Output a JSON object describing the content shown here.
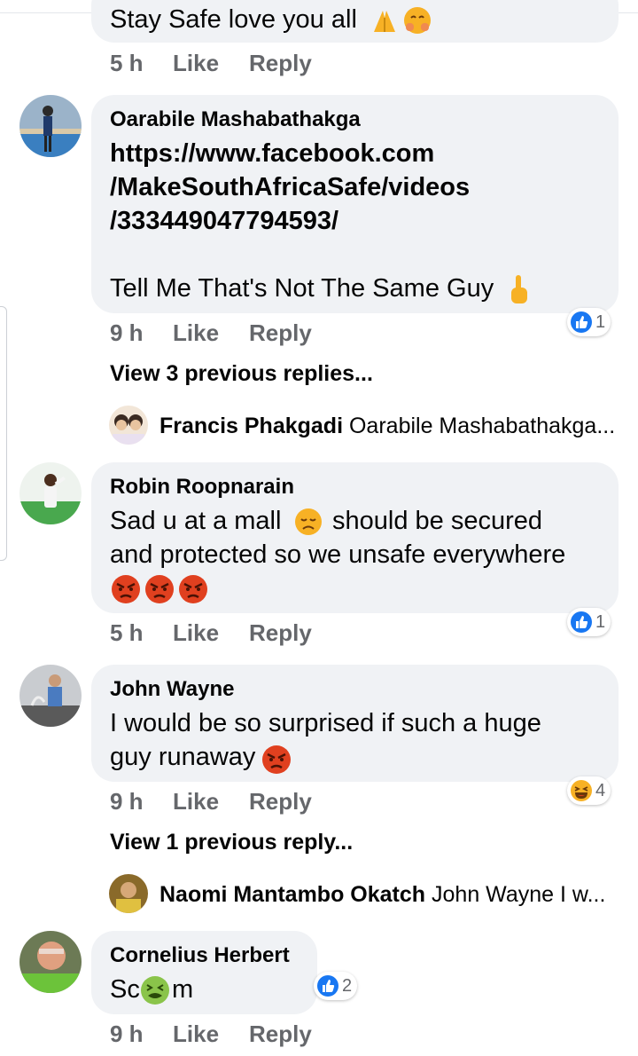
{
  "comments": [
    {
      "text": "Stay Safe love you all",
      "time": "5 h",
      "like": "Like",
      "reply": "Reply"
    },
    {
      "author": "Oarabile Mashabathakga",
      "link_lines": [
        "https://www.facebook.com",
        "/MakeSouthAfricaSafe/videos",
        "/333449047794593/"
      ],
      "text": "Tell Me That's Not The Same Guy",
      "reaction_icon": "like-icon",
      "reaction_count": "1",
      "time": "9 h",
      "like": "Like",
      "reply": "Reply",
      "view_previous": "View 3 previous replies...",
      "latest_reply": {
        "author": "Francis Phakgadi",
        "text": "Oarabile Mashabathakga..."
      }
    },
    {
      "author": "Robin Roopnarain",
      "text_line1": "Sad u at a mall",
      "text_line1b": "should be secured",
      "text_line2": "and protected so we unsafe everywhere",
      "reaction_icon": "like-icon",
      "reaction_count": "1",
      "time": "5 h",
      "like": "Like",
      "reply": "Reply"
    },
    {
      "author": "John Wayne",
      "text_line1": "I would be so surprised if such a huge",
      "text_line2": "guy runaway",
      "reaction_icon": "haha-icon",
      "reaction_count": "4",
      "time": "9 h",
      "like": "Like",
      "reply": "Reply",
      "view_previous": "View 1 previous reply...",
      "latest_reply": {
        "author": "Naomi Mantambo Okatch",
        "text": "John Wayne I w..."
      }
    },
    {
      "author": "Cornelius Herbert",
      "text_a": "Sc",
      "text_b": "m",
      "reaction_icon": "like-icon",
      "reaction_count": "2",
      "time": "9 h",
      "like": "Like",
      "reply": "Reply"
    }
  ],
  "colors": {
    "bubble": "#f0f2f5",
    "like_blue": "#1877f2",
    "meta_gray": "#65676b",
    "angry_red": "#e0401f",
    "emoji_yellow": "#f7b125"
  }
}
